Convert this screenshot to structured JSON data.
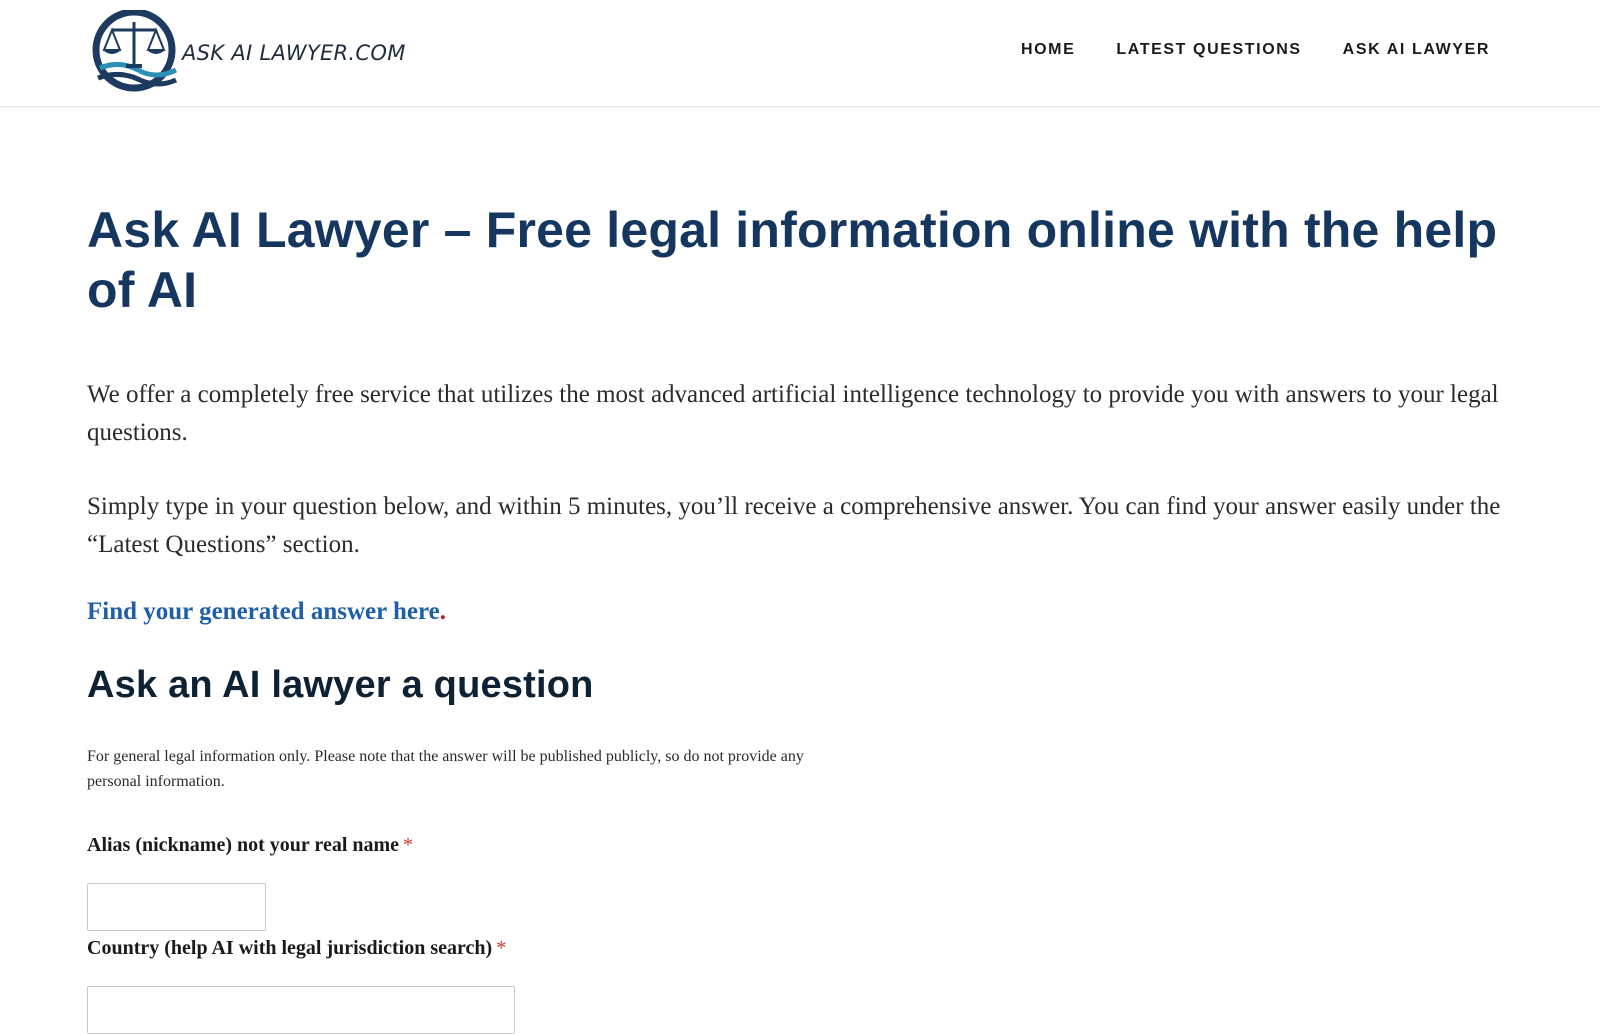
{
  "header": {
    "logo_text": "ASK AI LAWYER.COM",
    "nav": [
      {
        "label": "HOME"
      },
      {
        "label": "LATEST QUESTIONS"
      },
      {
        "label": "ASK AI LAWYER"
      }
    ]
  },
  "main": {
    "title": "Ask AI Lawyer – Free legal information online with the help of AI",
    "paragraph1": "We offer a completely free service that utilizes the most advanced artificial intelligence technology to provide you with answers to your legal questions.",
    "paragraph2": "Simply type in your question below, and within 5 minutes, you’ll receive a comprehensive answer. You can find your answer easily under the “Latest Questions” section.",
    "answer_link": "Find your generated answer here",
    "answer_link_suffix": ".",
    "section_title": "Ask an AI lawyer a question",
    "disclaimer": "For general legal information only. Please note that the answer will be published publicly, so do not provide any personal information."
  },
  "form": {
    "alias_label": "Alias (nickname) not your real name",
    "alias_value": "",
    "country_label": "Country (help AI with legal jurisdiction search)",
    "country_value": "",
    "required_marker": "*"
  },
  "colors": {
    "title": "#15365e",
    "link": "#1f5fa8",
    "required": "#d0312d",
    "logo_navy": "#1d3a5f",
    "logo_teal": "#2c8fb5"
  }
}
